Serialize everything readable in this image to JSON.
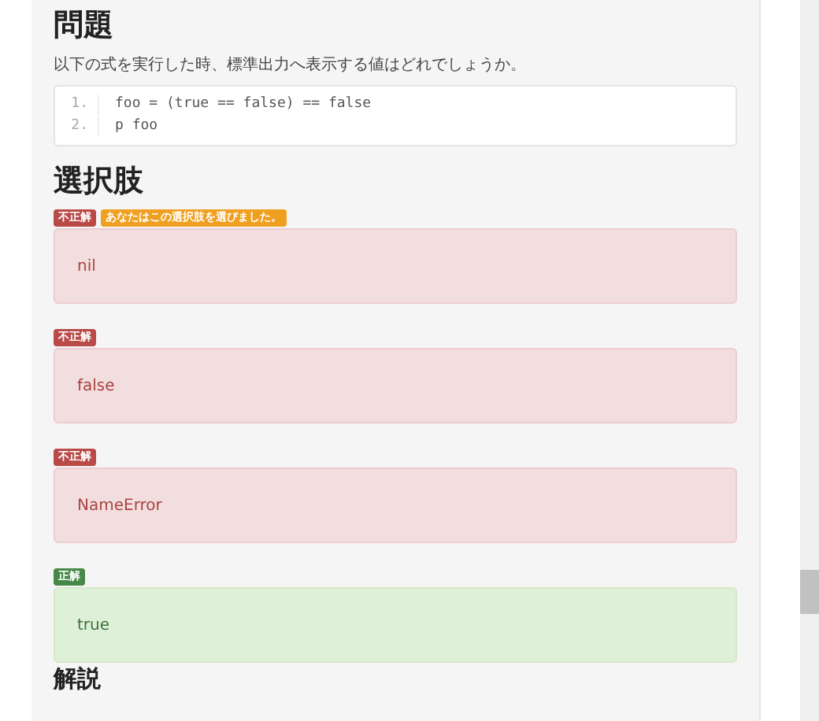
{
  "question": {
    "heading": "問題",
    "text": "以下の式を実行した時、標準出力へ表示する値はどれでしょうか。",
    "code": [
      {
        "number": "1.",
        "code": "foo = (true == false) == false"
      },
      {
        "number": "2.",
        "code": "p foo"
      }
    ]
  },
  "choices": {
    "heading": "選択肢",
    "options": [
      {
        "badge": "不正解",
        "correct": false,
        "selected": true,
        "note": "あなたはこの選択肢を選びました。",
        "text": "nil"
      },
      {
        "badge": "不正解",
        "correct": false,
        "selected": false,
        "text": "false"
      },
      {
        "badge": "不正解",
        "correct": false,
        "selected": false,
        "text": "NameError"
      },
      {
        "badge": "正解",
        "correct": true,
        "selected": false,
        "text": "true"
      }
    ]
  },
  "explanation": {
    "heading": "解説"
  }
}
